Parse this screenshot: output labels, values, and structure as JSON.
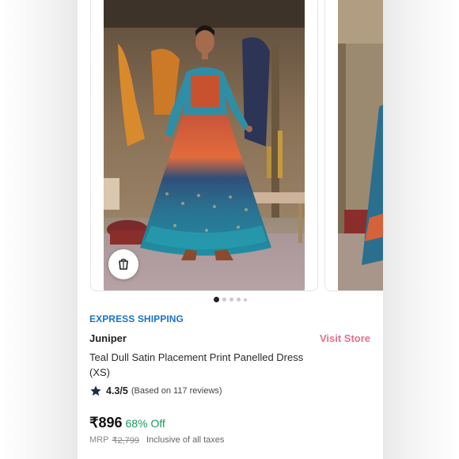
{
  "carousel": {
    "slides": [
      {
        "alt": "Model wearing teal dull satin placement print panelled dress"
      },
      {
        "alt": "Dress alternate view"
      }
    ],
    "active_index": 0,
    "dot_count": 5
  },
  "shipping_badge": "EXPRESS SHIPPING",
  "product": {
    "brand": "Juniper",
    "visit_store_label": "Visit Store",
    "title": "Teal Dull Satin Placement Print Panelled Dress (XS)",
    "rating": {
      "score": "4.3/5",
      "reviews": "(Based on 117 reviews)"
    },
    "price": "₹896",
    "discount": "68% Off",
    "mrp_label": "MRP",
    "mrp_value": "₹2,799",
    "tax_note": "Inclusive of all taxes"
  },
  "colors": {
    "express": "#1a73c8",
    "visit_store": "#e8708a",
    "discount": "#1a9b5a"
  },
  "icons": {
    "similar": "similar-products-icon",
    "star": "star-icon"
  }
}
